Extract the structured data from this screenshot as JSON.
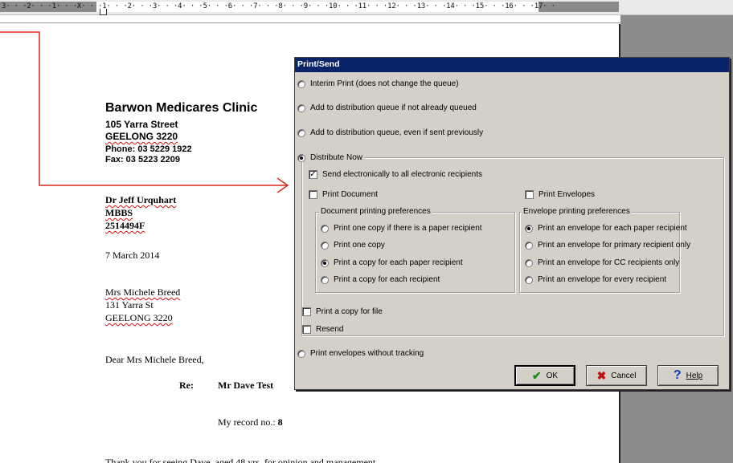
{
  "ruler": {
    "text": "3· · ·2· · ·1· · ·X· · ·1· · ·2· · ·3· · ·4· · ·5· · ·6· · ·7· · ·8· · ·9· · ·10· · ·11· · ·12· · ·13· · ·14· · ·15· · ·16· · ·17· ·"
  },
  "letter": {
    "clinic_name": "Barwon Medicares Clinic",
    "street": "105 Yarra Street",
    "city": "GEELONG  3220",
    "phone": "Phone: 03 5229 1922",
    "fax": "Fax: 03 5223 2209",
    "doctor": "Dr Jeff Urquhart",
    "qualification": "MBBS",
    "provider_number": "2514494F",
    "date": "7 March 2014",
    "recipient_name": "Mrs Michele Breed",
    "recipient_street": "131 Yarra St",
    "recipient_city": "GEELONG 3220",
    "salutation": "Dear Mrs Michele Breed,",
    "re_label": "Re:",
    "re_value": "Mr Dave Test",
    "record_label": "My record no.: ",
    "record_value": "8",
    "body_partial": "Thank you for seeing Dave, aged 48 yrs, for opinion and management."
  },
  "dialog": {
    "title": "Print/Send",
    "options": {
      "interim": "Interim Print (does not change the queue)",
      "add_queue": "Add to distribution queue if not already queued",
      "add_queue_even": "Add to distribution queue, even if sent previously",
      "distribute_now": "Distribute Now",
      "envelopes_no_tracking": "Print envelopes without tracking"
    },
    "selected_option": "distribute_now",
    "send_electronic": {
      "label": "Send electronically to all electronic recipients",
      "checked": true
    },
    "print_document": {
      "label": "Print Document",
      "checked": false
    },
    "print_envelopes": {
      "label": "Print Envelopes",
      "checked": false
    },
    "doc_prefs": {
      "caption": "Document printing preferences",
      "items": [
        "Print one copy if there is a paper recipient",
        "Print one copy",
        "Print a copy for each paper recipient",
        "Print a copy for each recipient"
      ],
      "selected": 2
    },
    "env_prefs": {
      "caption": "Envelope printing preferences",
      "items": [
        "Print an envelope for each paper recipient",
        "Print an envelope for primary recipient only",
        "Print an envelope for CC recipients only",
        "Print an envelope for every recipient"
      ],
      "selected": 0
    },
    "print_copy_file": {
      "label": "Print a copy for file",
      "checked": false
    },
    "resend": {
      "label": "Resend",
      "checked": false
    },
    "buttons": {
      "ok": "OK",
      "cancel": "Cancel",
      "help": "Help"
    },
    "colors": {
      "titlebar": "#0a246a",
      "face": "#d4d0c8",
      "ok_icon": "#1a8a1a",
      "cancel_icon": "#c01010",
      "help_icon": "#1040c0"
    }
  }
}
